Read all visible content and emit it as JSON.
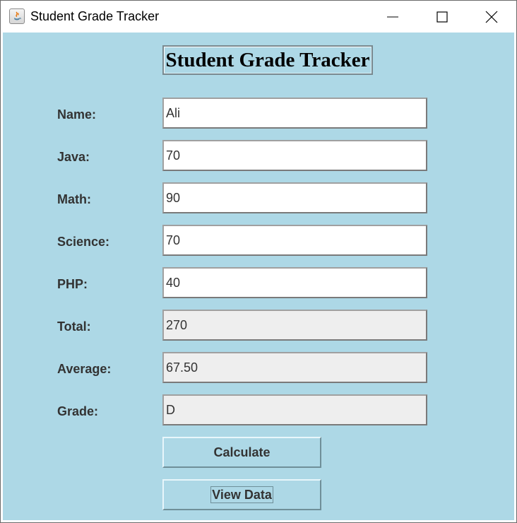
{
  "window": {
    "title": "Student Grade Tracker",
    "icon": "java-icon"
  },
  "header": {
    "title": "Student Grade Tracker"
  },
  "form": {
    "name": {
      "label": "Name:",
      "value": "Ali"
    },
    "java": {
      "label": "Java:",
      "value": "70"
    },
    "math": {
      "label": "Math:",
      "value": "90"
    },
    "science": {
      "label": "Science:",
      "value": "70"
    },
    "php": {
      "label": "PHP:",
      "value": "40"
    }
  },
  "results": {
    "total": {
      "label": "Total:",
      "value": "270"
    },
    "average": {
      "label": "Average:",
      "value": "67.50"
    },
    "grade": {
      "label": "Grade:",
      "value": "D"
    }
  },
  "buttons": {
    "calculate": "Calculate",
    "view_data": "View Data"
  },
  "colors": {
    "background": "#add8e6",
    "readonly_field": "#eeeeee",
    "text": "#333333"
  }
}
